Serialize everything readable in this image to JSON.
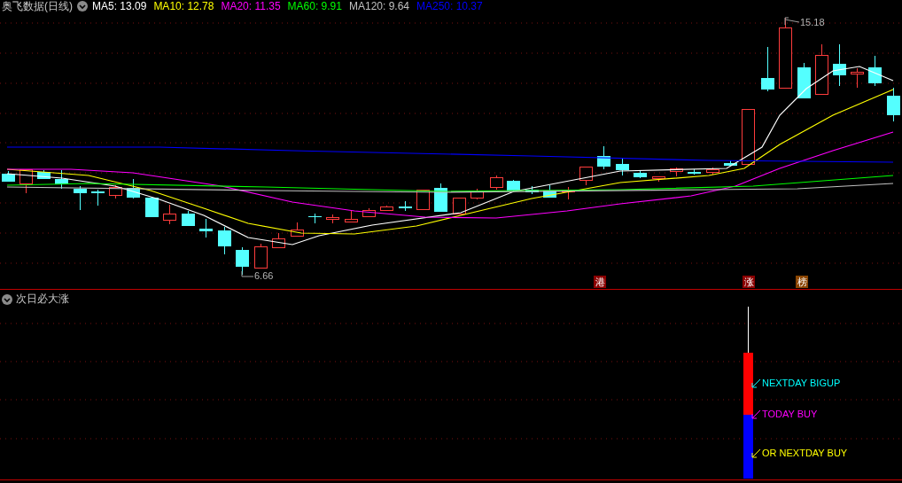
{
  "header": {
    "title": "奥飞数据(日线)",
    "moving_averages": [
      {
        "label": "MA5: 13.09",
        "color": "#ffffff"
      },
      {
        "label": "MA10: 12.78",
        "color": "#ffff00"
      },
      {
        "label": "MA20: 11.35",
        "color": "#ff00ff"
      },
      {
        "label": "MA60: 9.91",
        "color": "#00ff00"
      },
      {
        "label": "MA120: 9.64",
        "color": "#c0c0c0"
      },
      {
        "label": "MA250: 10.37",
        "color": "#0000ff"
      }
    ]
  },
  "price_chart": {
    "low_label": "6.66",
    "high_label": "15.18",
    "tags": [
      {
        "text": "港",
        "color": "#8b0000"
      },
      {
        "text": "涨",
        "color": "#8b0000"
      },
      {
        "text": "榜",
        "color": "#8b4500"
      }
    ]
  },
  "signal_panel": {
    "title": "次日必大涨",
    "signals": [
      {
        "text": "NEXTDAY BIGUP",
        "color": "#00ffff"
      },
      {
        "text": "TODAY BUY",
        "color": "#ff00ff"
      },
      {
        "text": "OR NEXTDAY BUY",
        "color": "#ffff00"
      }
    ]
  }
}
